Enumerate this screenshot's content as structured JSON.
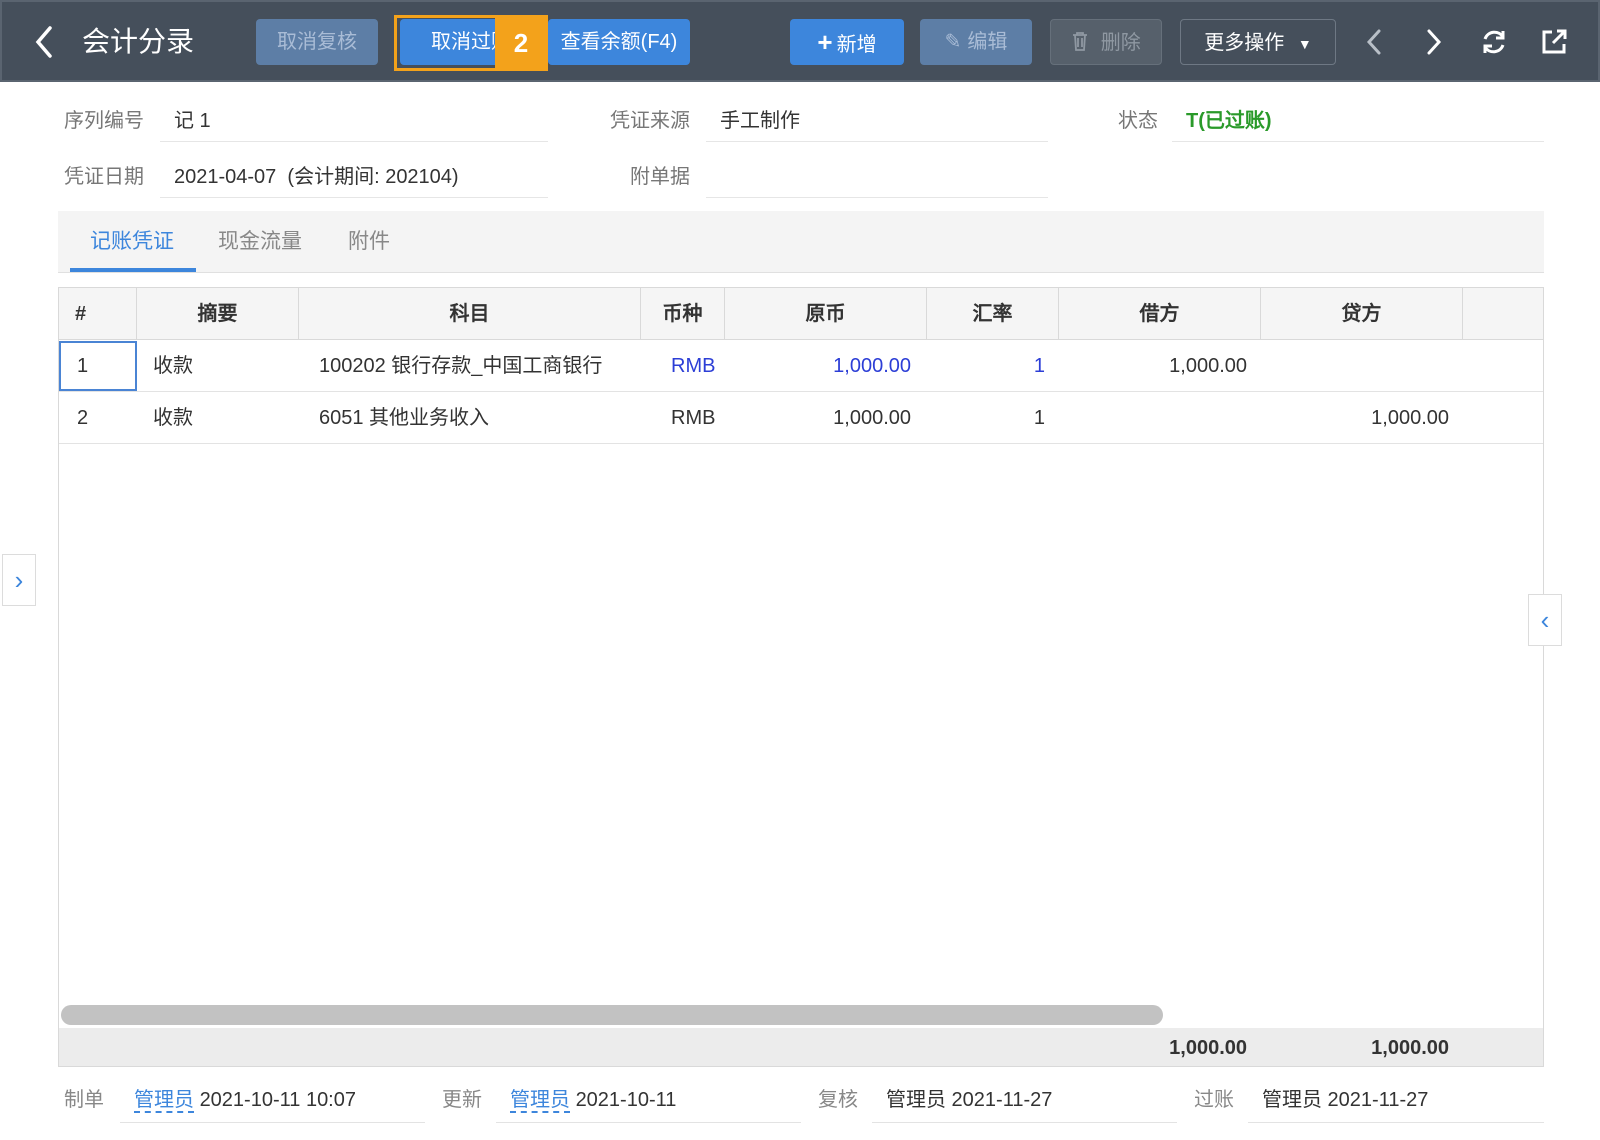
{
  "header": {
    "title": "会计分录",
    "buttons": {
      "cancel_review": "取消复核",
      "cancel_post": "取消过账",
      "view_balance": "查看余额(F4)",
      "add": "新增",
      "edit": "编辑",
      "delete": "删除",
      "more": "更多操作"
    },
    "step_badge": "2"
  },
  "form": {
    "serial_label": "序列编号",
    "serial_value": "记 1",
    "source_label": "凭证来源",
    "source_value": "手工制作",
    "status_label": "状态",
    "status_value": "T(已过账)",
    "date_label": "凭证日期",
    "date_value": "2021-04-07  (会计期间: 202104)",
    "attachments_label": "附单据",
    "attachments_value": ""
  },
  "tabs": [
    "记账凭证",
    "现金流量",
    "附件"
  ],
  "table": {
    "headers": [
      "#",
      "摘要",
      "科目",
      "币种",
      "原币",
      "汇率",
      "借方",
      "贷方"
    ],
    "rows": [
      {
        "no": "1",
        "summary": "收款",
        "account": "100202 银行存款_中国工商银行",
        "currency": "RMB",
        "original": "1,000.00",
        "rate": "1",
        "debit": "1,000.00",
        "credit": ""
      },
      {
        "no": "2",
        "summary": "收款",
        "account": "6051 其他业务收入",
        "currency": "RMB",
        "original": "1,000.00",
        "rate": "1",
        "debit": "",
        "credit": "1,000.00"
      }
    ],
    "totals": {
      "debit": "1,000.00",
      "credit": "1,000.00"
    }
  },
  "footer": {
    "created_label": "制单",
    "created_user": "管理员",
    "created_time": "2021-10-11 10:07",
    "updated_label": "更新",
    "updated_user": "管理员",
    "updated_time": "2021-10-11",
    "reviewed_label": "复核",
    "reviewed_value": "管理员 2021-11-27",
    "posted_label": "过账",
    "posted_value": "管理员 2021-11-27"
  },
  "colors": {
    "header_bg": "#454f5b",
    "accent": "#3d86dc",
    "highlight": "#f3a21b",
    "status_green": "#2a9a2a",
    "link_blue": "#2c3ed6"
  },
  "icons": {
    "back": "chevron-left-icon",
    "add": "plus-icon",
    "edit": "edit-icon",
    "delete": "trash-icon",
    "more": "caret-down-icon",
    "prev": "chevron-left-icon",
    "next": "chevron-right-icon",
    "refresh": "refresh-icon",
    "export": "external-link-icon"
  }
}
